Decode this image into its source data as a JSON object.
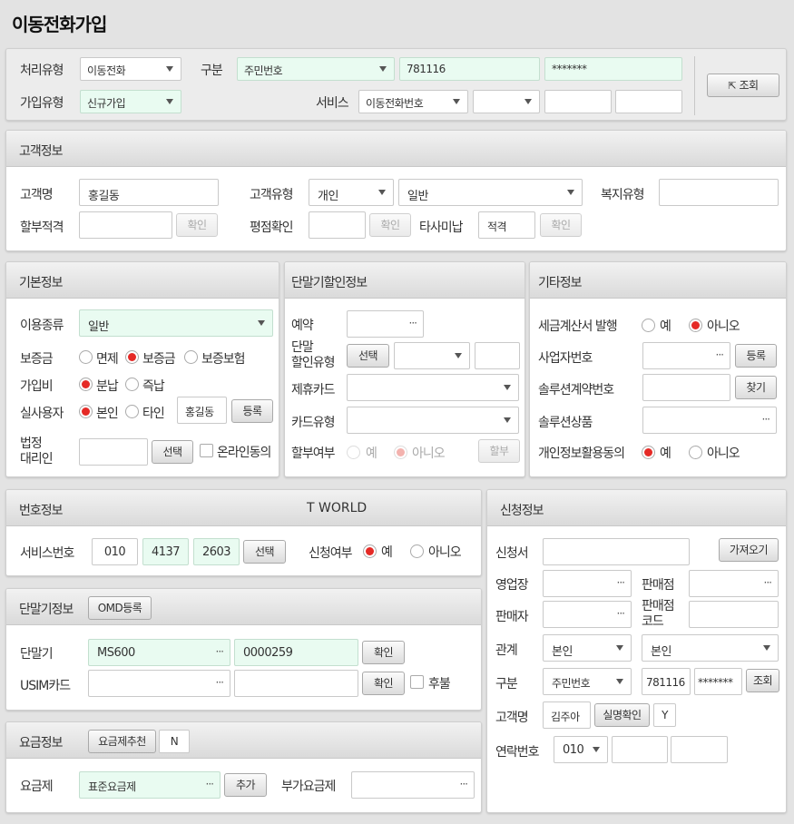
{
  "page_title": "이동전화가입",
  "top": {
    "proc_type_label": "처리유형",
    "proc_type_value": "이동전화",
    "gubun_label": "구분",
    "gubun_value": "주민번호",
    "id_front": "781116",
    "id_back": "*******",
    "join_type_label": "가입유형",
    "join_type_value": "신규가입",
    "service_label": "서비스",
    "service_value": "이동전화번호",
    "search_button": "조회"
  },
  "customer": {
    "title": "고객정보",
    "name_label": "고객명",
    "name_value": "홍길동",
    "type_label": "고객유형",
    "type_value1": "개인",
    "type_value2": "일반",
    "welfare_label": "복지유형",
    "installment_label": "할부적격",
    "confirm": "확인",
    "credit_label": "평점확인",
    "other_unpaid_label": "타사미납",
    "other_unpaid_value": "적격"
  },
  "basic": {
    "title": "기본정보",
    "usage_label": "이용종류",
    "usage_value": "일반",
    "deposit_label": "보증금",
    "deposit_options": [
      "면제",
      "보증금",
      "보증보험"
    ],
    "join_fee_label": "가입비",
    "join_fee_options": [
      "분납",
      "즉납"
    ],
    "real_user_label": "실사용자",
    "real_user_options": [
      "본인",
      "타인"
    ],
    "real_user_name": "홍길동",
    "register": "등록",
    "legal_rep_label": [
      "법정",
      "대리인"
    ],
    "select": "선택",
    "online_consent": "온라인동의"
  },
  "discount": {
    "title": "단말기할인정보",
    "reserve_label": "예약",
    "reserve_dots": "···",
    "disc_type_label": [
      "단말",
      "할인유형"
    ],
    "select": "선택",
    "card_label": "제휴카드",
    "card_type_label": "카드유형",
    "installment_label": "할부여부",
    "yes": "예",
    "no": "아니오",
    "installment_btn": "할부"
  },
  "etc": {
    "title": "기타정보",
    "tax_label": "세금계산서 발행",
    "yes": "예",
    "no": "아니오",
    "biz_label": "사업자번호",
    "dots": "···",
    "register": "등록",
    "solution_contract_label": "솔루션계약번호",
    "find": "찾기",
    "solution_product_label": "솔루션상품",
    "privacy_label": "개인정보활용동의"
  },
  "number": {
    "title": "번호정보",
    "tworld": "T WORLD",
    "service_no_label": "서비스번호",
    "no1": "010",
    "no2": "4137",
    "no3": "2603",
    "select": "선택",
    "apply_label": "신청여부",
    "yes": "예",
    "no": "아니오"
  },
  "device": {
    "title": "단말기정보",
    "omd_button": "OMD등록",
    "device_label": "단말기",
    "model": "MS600",
    "dots": "···",
    "serial": "0000259",
    "confirm": "확인",
    "usim_label": "USIM카드",
    "postpaid": "후불"
  },
  "fee": {
    "title": "요금정보",
    "recommend_button": "요금제추천",
    "recommend_value": "N",
    "plan_label": "요금제",
    "plan_value": "표준요금제",
    "dots": "···",
    "add": "추가",
    "extra_label": "부가요금제"
  },
  "apply": {
    "title": "신청정보",
    "applicant_label": "신청서",
    "fetch": "가져오기",
    "office_label": "영업장",
    "shop_label": "판매점",
    "dots": "···",
    "seller_label": "판매자",
    "shop_code_label": [
      "판매점",
      "코드"
    ],
    "relation_label": "관계",
    "relation1": "본인",
    "relation2": "본인",
    "gubun_label": "구분",
    "gubun_value": "주민번호",
    "id_front": "781116",
    "id_back": "*******",
    "search": "조회",
    "customer_label": "고객명",
    "customer_value": "김주아",
    "realname_check": "실명확인",
    "realname_value": "Y",
    "contact_label": "연락번호",
    "contact_prefix": "010"
  }
}
